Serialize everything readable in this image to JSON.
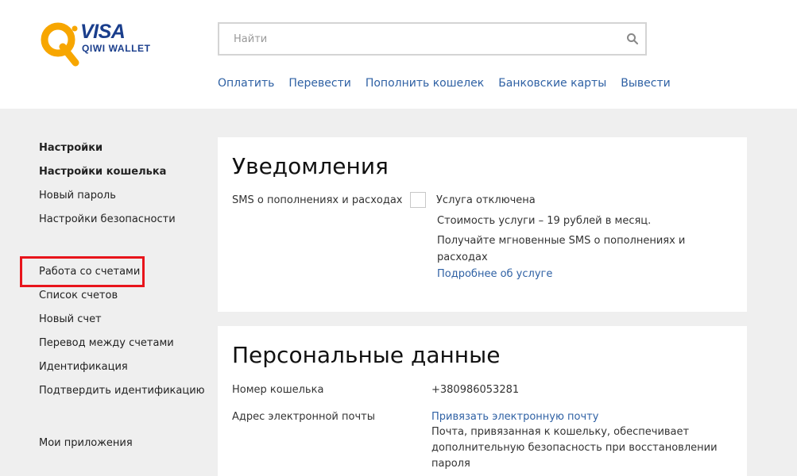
{
  "logo": {
    "brand": "VISA",
    "product": "QIWI WALLET"
  },
  "search": {
    "placeholder": "Найти"
  },
  "topnav": [
    "Оплатить",
    "Перевести",
    "Пополнить кошелек",
    "Банковские карты",
    "Вывести"
  ],
  "sidebar": {
    "settings_header": "Настройки",
    "wallet_settings": "Настройки кошелька",
    "new_password": "Новый пароль",
    "security_settings": "Настройки безопасности",
    "accounts_header": "Работа со счетами",
    "accounts_list": "Список счетов",
    "new_account": "Новый счет",
    "transfer_between": "Перевод между счетами",
    "identification": "Идентификация",
    "confirm_identification": "Подтвердить идентификацию",
    "my_apps": "Мои приложения"
  },
  "notifications": {
    "title": "Уведомления",
    "sms_label": "SMS о пополнениях и расходах",
    "status": "Услуга отключена",
    "cost": "Стоимость услуги – 19 рублей в месяц.",
    "description_line1": "Получайте мгновенные SMS о пополнениях и",
    "description_line2": "расходах",
    "more_link": "Подробнее об услуге"
  },
  "personal": {
    "title": "Персональные данные",
    "wallet_label": "Номер кошелька",
    "wallet_value": "+380986053281",
    "email_label": "Адрес электронной почты",
    "email_link": "Привязать электронную почту",
    "email_note_line1": "Почта, привязанная к кошельку, обеспечивает",
    "email_note_line2": "дополнительную безопасность при восстановлении",
    "email_note_line3": "пароля"
  },
  "colors": {
    "link": "#2f61a4",
    "logo_orange": "#f7a600",
    "logo_blue": "#1a3e8c",
    "highlight": "#e8141b"
  }
}
